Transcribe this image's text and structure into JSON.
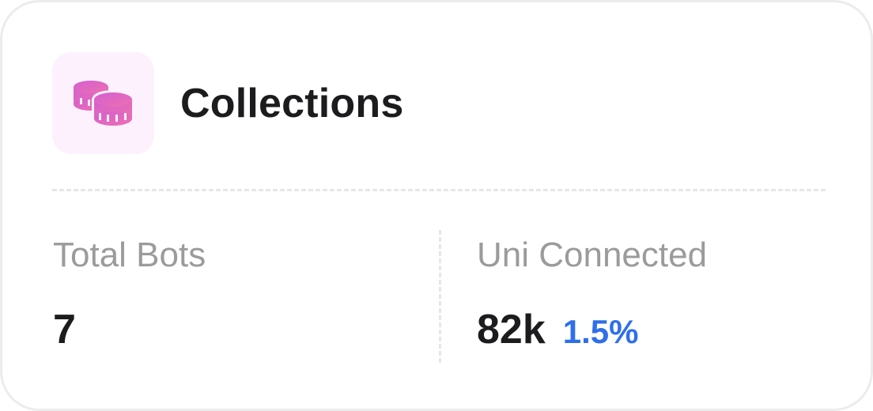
{
  "card": {
    "title": "Collections",
    "icon": "coins-icon",
    "accent_color": "#e062c8",
    "icon_bg_color": "#fcf1fd"
  },
  "stats": [
    {
      "label": "Total Bots",
      "value": "7",
      "change": ""
    },
    {
      "label": "Uni Connected",
      "value": "82k",
      "change": "1.5%",
      "change_color": "#2f6fe8"
    }
  ]
}
